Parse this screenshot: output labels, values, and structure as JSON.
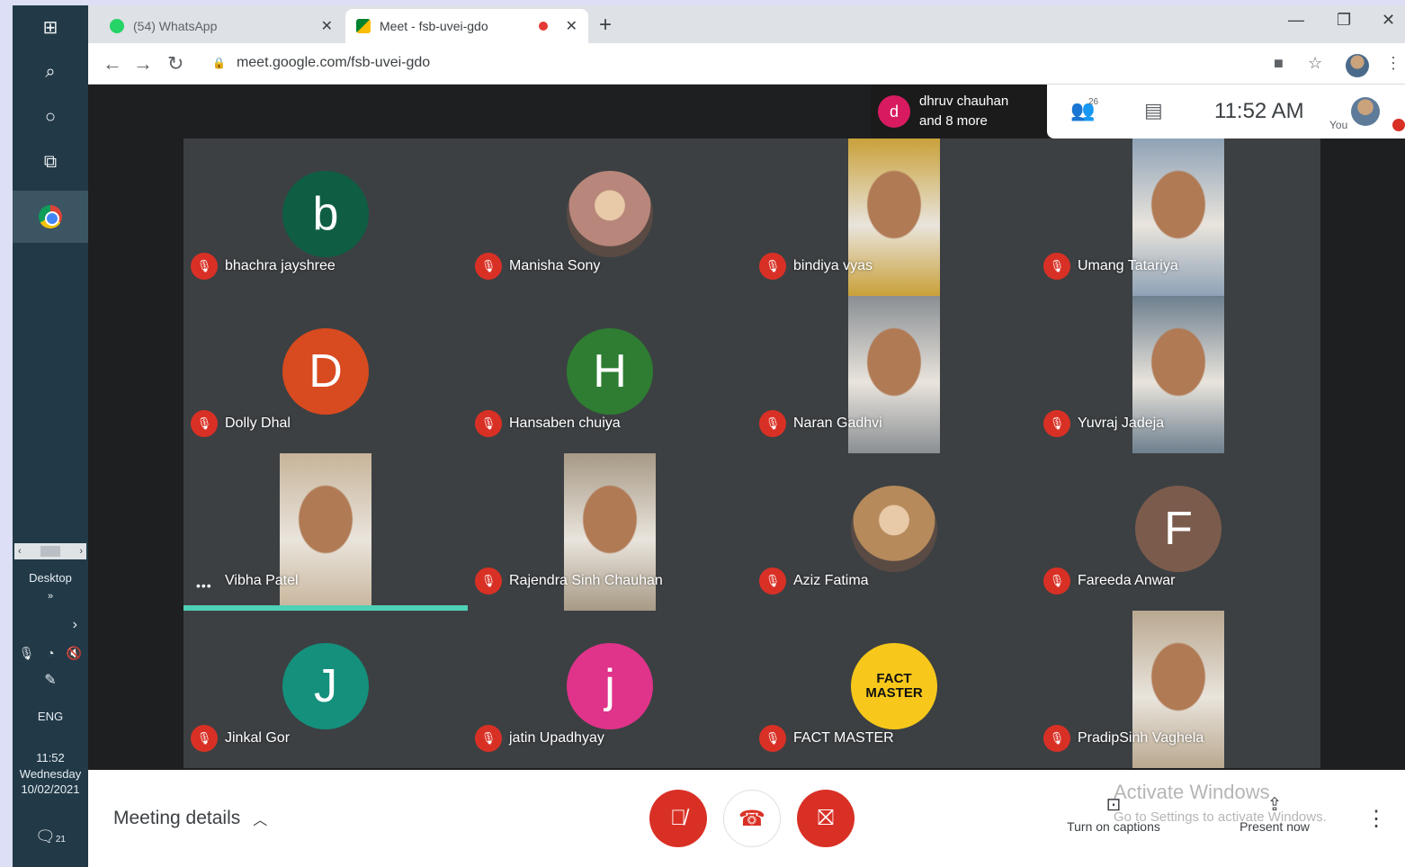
{
  "taskbar": {
    "desktop_label": "Desktop",
    "lang": "ENG",
    "time": "11:52",
    "day": "Wednesday",
    "date": "10/02/2021",
    "notif_count": "21"
  },
  "browser": {
    "tabs": [
      {
        "label": "(54) WhatsApp",
        "active": false
      },
      {
        "label": "Meet - fsb-uvei-gdo",
        "active": true
      }
    ],
    "url": "meet.google.com/fsb-uvei-gdo"
  },
  "meet": {
    "presenter_chip": {
      "initial": "d",
      "line1": "dhruv chauhan",
      "line2": "and 8 more"
    },
    "participant_count": "26",
    "clock": "11:52 AM",
    "you_label": "You",
    "participants": [
      {
        "name": "bhachra jayshree",
        "type": "avatar",
        "initial": "b",
        "color": "#0f5e44"
      },
      {
        "name": "Manisha Sony",
        "type": "photo-circle",
        "color": "#b8867a"
      },
      {
        "name": "bindiya vyas",
        "type": "video",
        "color": "#c9a13a"
      },
      {
        "name": "Umang Tatariya",
        "type": "video",
        "color": "#8fa2b6"
      },
      {
        "name": "Dolly Dhal",
        "type": "avatar",
        "initial": "D",
        "color": "#d84a1f"
      },
      {
        "name": "Hansaben chuiya",
        "type": "avatar",
        "initial": "H",
        "color": "#2e7d32"
      },
      {
        "name": "Naran Gadhvi",
        "type": "video",
        "color": "#8a8f94"
      },
      {
        "name": "Yuvraj Jadeja",
        "type": "video",
        "color": "#6d7f8e"
      },
      {
        "name": "Vibha Patel",
        "type": "video",
        "color": "#c7b49a",
        "speaking": true
      },
      {
        "name": "Rajendra Sinh Chauhan",
        "type": "video",
        "color": "#a79a86"
      },
      {
        "name": "Aziz Fatima",
        "type": "photo-circle",
        "color": "#b68a5a"
      },
      {
        "name": "Fareeda Anwar",
        "type": "avatar",
        "initial": "F",
        "color": "#7b5b4c"
      },
      {
        "name": "Jinkal Gor",
        "type": "avatar",
        "initial": "J",
        "color": "#14907c"
      },
      {
        "name": "jatin Upadhyay",
        "type": "avatar",
        "initial": "j",
        "color": "#e0338a"
      },
      {
        "name": "FACT MASTER",
        "type": "logo",
        "logo_text": "FACT MASTER",
        "color": "#f7c81b"
      },
      {
        "name": "PradipSinh Vaghela",
        "type": "video",
        "color": "#b9a890"
      }
    ]
  },
  "bottom": {
    "meeting_details": "Meeting details",
    "captions": "Turn on captions",
    "present": "Present now",
    "watermark_title": "Activate Windows",
    "watermark_sub": "Go to Settings to activate Windows."
  }
}
